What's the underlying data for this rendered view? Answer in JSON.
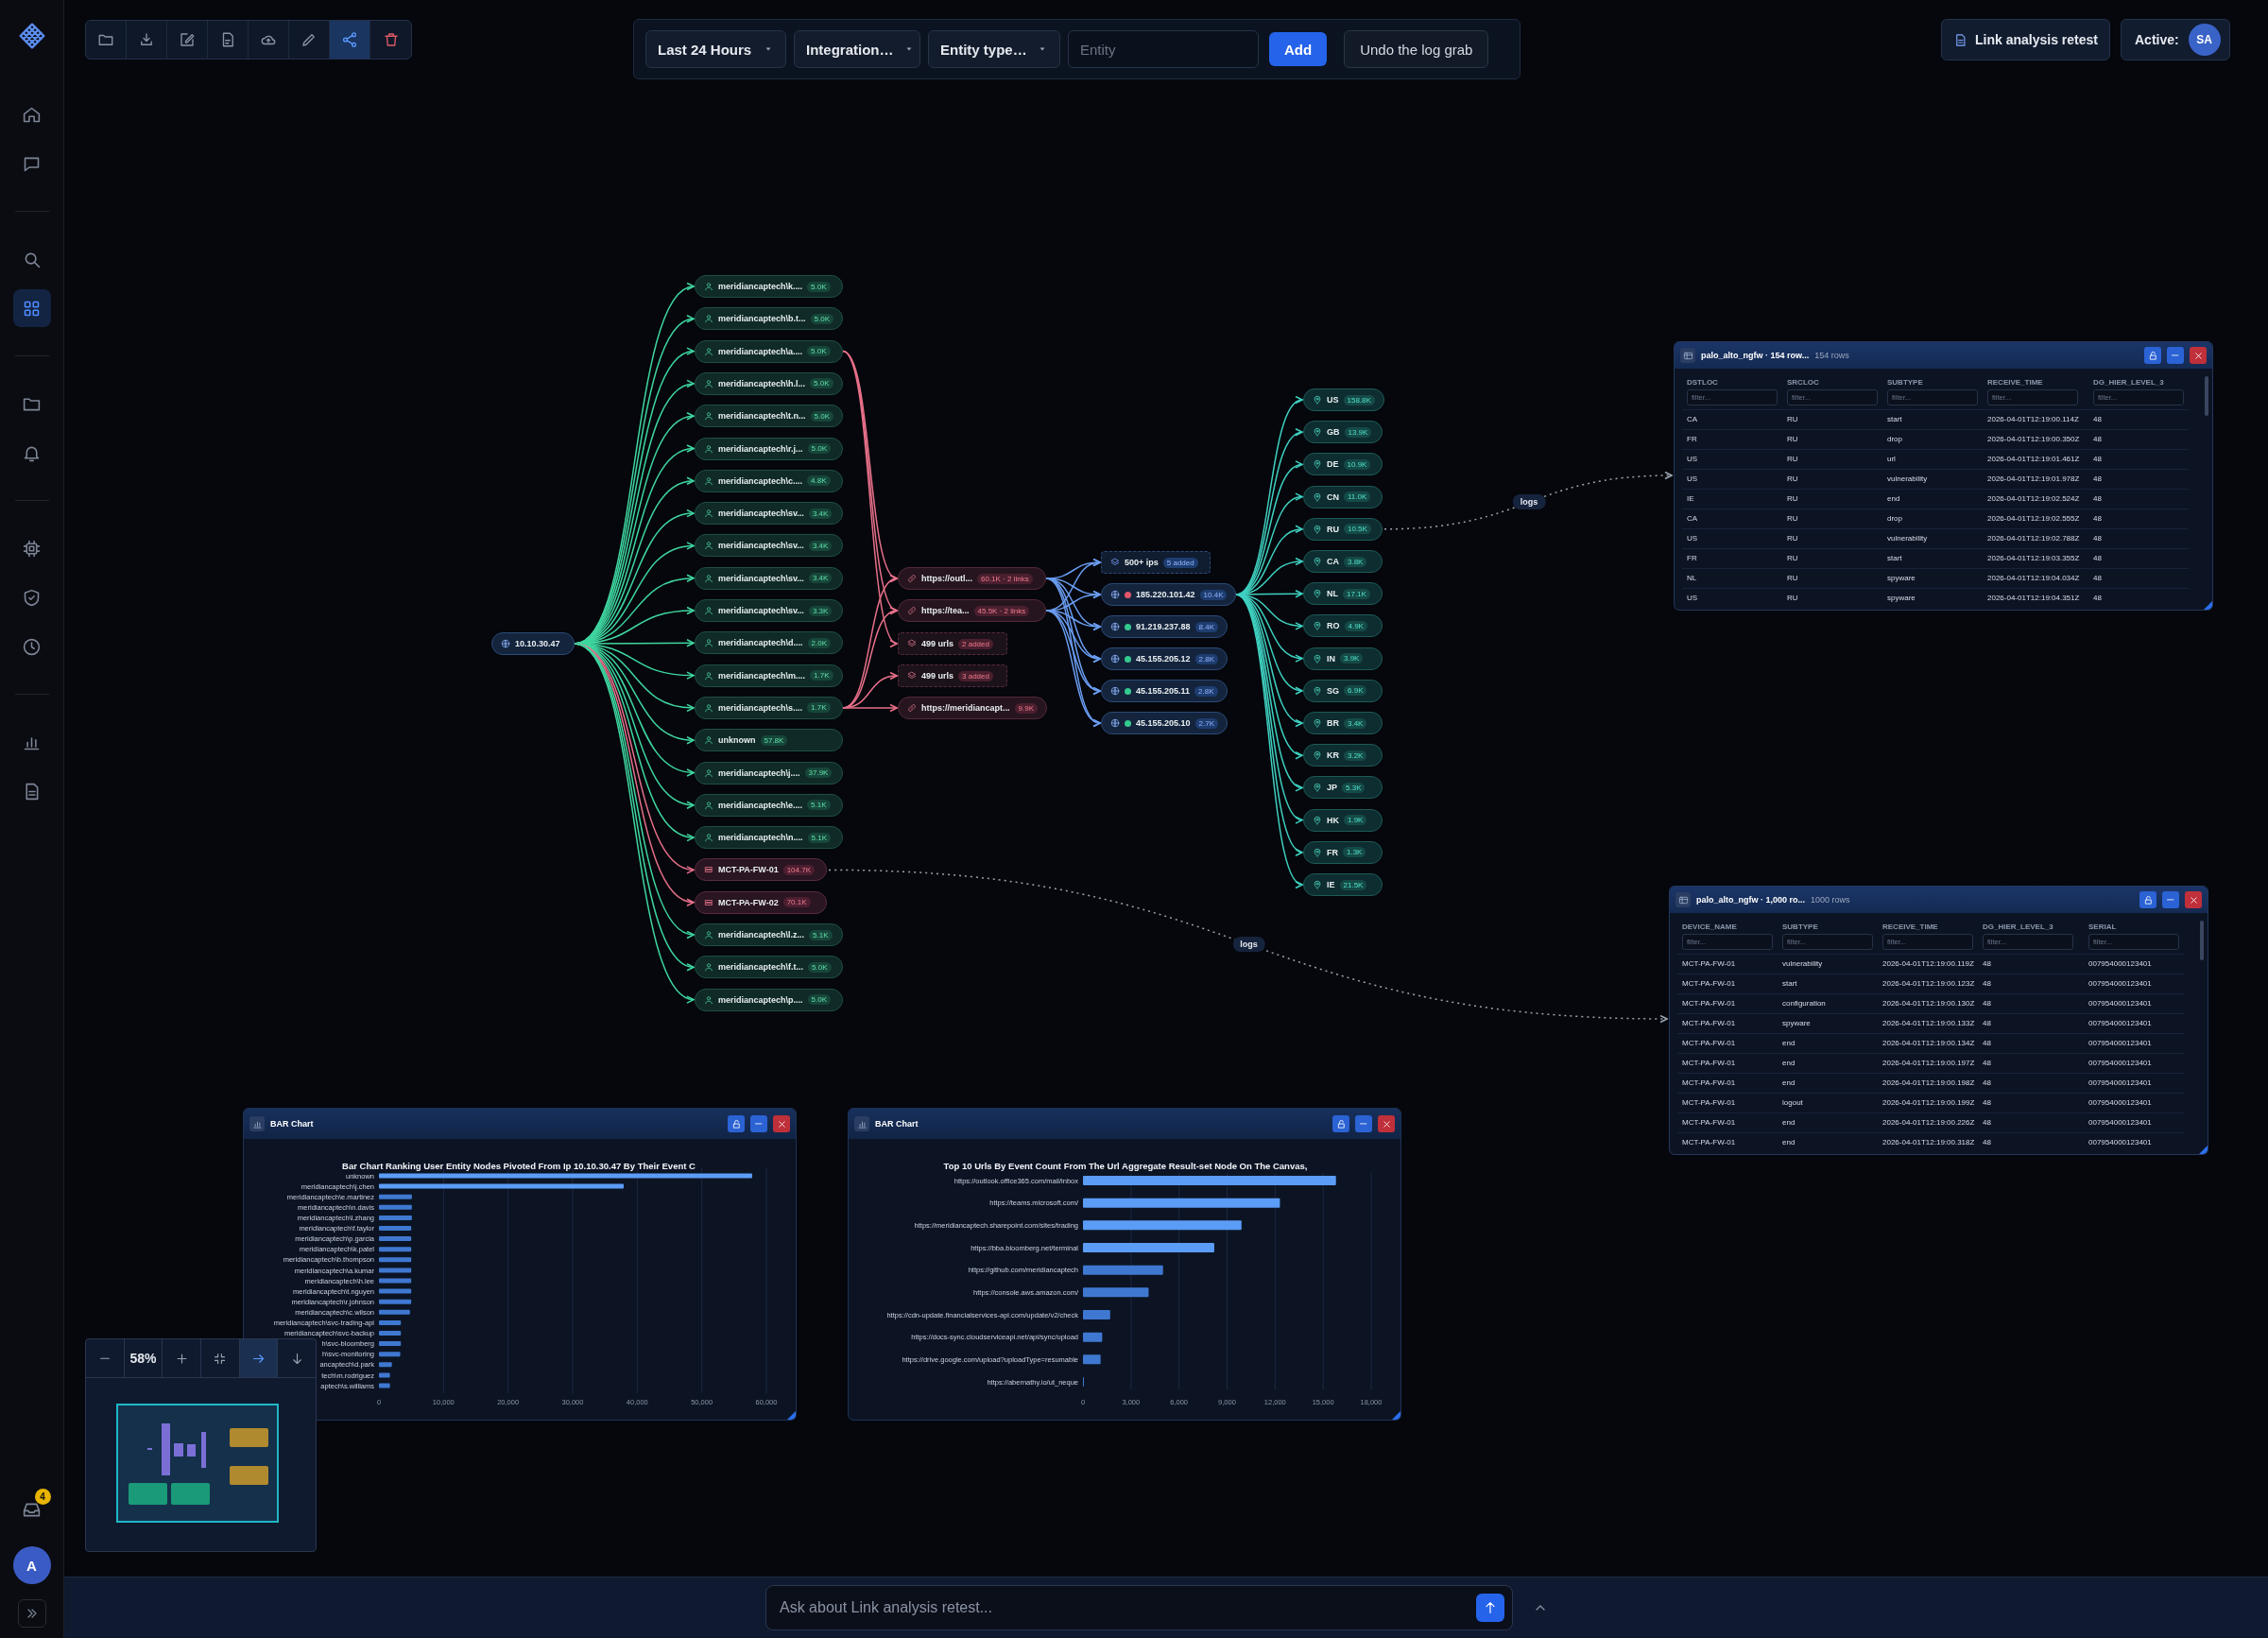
{
  "sidebar": {
    "groups": [
      {
        "items": [
          {
            "kind": "home",
            "selected": false
          },
          {
            "kind": "chat",
            "selected": false
          }
        ]
      },
      {
        "items": [
          {
            "kind": "search",
            "selected": false
          },
          {
            "kind": "grid",
            "selected": true
          }
        ]
      },
      {
        "items": [
          {
            "kind": "folder",
            "selected": false
          },
          {
            "kind": "bell",
            "selected": false
          }
        ]
      },
      {
        "items": [
          {
            "kind": "chip",
            "selected": false
          },
          {
            "kind": "shield",
            "selected": false
          },
          {
            "kind": "clock",
            "selected": false
          }
        ]
      },
      {
        "items": [
          {
            "kind": "chart",
            "selected": false
          },
          {
            "kind": "doc",
            "selected": false
          }
        ]
      }
    ],
    "inbox": {
      "badge": "4"
    },
    "account": {
      "initial": "A"
    }
  },
  "toolbar": [
    {
      "kind": "folder",
      "selected": false
    },
    {
      "kind": "download",
      "selected": false
    },
    {
      "kind": "edit",
      "selected": false
    },
    {
      "kind": "file",
      "selected": false
    },
    {
      "kind": "cloud",
      "selected": false
    },
    {
      "kind": "pencil",
      "selected": false
    },
    {
      "kind": "share",
      "selected": true
    },
    {
      "kind": "trash",
      "selected": false
    }
  ],
  "filters": {
    "time_range": "Last 24 Hours",
    "integration": "Integration…",
    "entity_type": "Entity type…",
    "entity": {
      "placeholder": "Entity"
    },
    "add_button": "Add",
    "undo_button": "Undo the log grab"
  },
  "session": {
    "project_button": "Link analysis retest",
    "active_label": "Active:",
    "active_user": "SA"
  },
  "graph": {
    "root": {
      "kind": "ip",
      "label": "10.10.30.47"
    },
    "users": [
      {
        "kind": "user",
        "label": "meridiancaptech\\k....",
        "count": "5.0K"
      },
      {
        "kind": "user",
        "label": "meridiancaptech\\b.t...",
        "count": "5.0K"
      },
      {
        "kind": "user",
        "label": "meridiancaptech\\a....",
        "count": "5.0K"
      },
      {
        "kind": "user",
        "label": "meridiancaptech\\h.l...",
        "count": "5.0K"
      },
      {
        "kind": "user",
        "label": "meridiancaptech\\t.n...",
        "count": "5.0K"
      },
      {
        "kind": "user",
        "label": "meridiancaptech\\r.j...",
        "count": "5.0K"
      },
      {
        "kind": "user",
        "label": "meridiancaptech\\c....",
        "count": "4.8K"
      },
      {
        "kind": "user",
        "label": "meridiancaptech\\sv...",
        "count": "3.4K"
      },
      {
        "kind": "user",
        "label": "meridiancaptech\\sv...",
        "count": "3.4K"
      },
      {
        "kind": "user",
        "label": "meridiancaptech\\sv...",
        "count": "3.4K"
      },
      {
        "kind": "user",
        "label": "meridiancaptech\\sv...",
        "count": "3.3K"
      },
      {
        "kind": "user",
        "label": "meridiancaptech\\d....",
        "count": "2.0K"
      },
      {
        "kind": "user",
        "label": "meridiancaptech\\m....",
        "count": "1.7K"
      },
      {
        "kind": "user",
        "label": "meridiancaptech\\s....",
        "count": "1.7K"
      },
      {
        "kind": "user",
        "label": "unknown",
        "count": "57.8K"
      },
      {
        "kind": "user",
        "label": "meridiancaptech\\j....",
        "count": "37.9K"
      },
      {
        "kind": "user",
        "label": "meridiancaptech\\e....",
        "count": "5.1K"
      },
      {
        "kind": "user",
        "label": "meridiancaptech\\n....",
        "count": "5.1K"
      },
      {
        "kind": "device",
        "label": "MCT-PA-FW-01",
        "count": "104.7K"
      },
      {
        "kind": "device",
        "label": "MCT-PA-FW-02",
        "count": "70.1K"
      },
      {
        "kind": "user",
        "label": "meridiancaptech\\l.z...",
        "count": "5.1K"
      },
      {
        "kind": "user",
        "label": "meridiancaptech\\f.t...",
        "count": "5.0K"
      },
      {
        "kind": "user",
        "label": "meridiancaptech\\p....",
        "count": "5.0K"
      }
    ],
    "urls": [
      {
        "kind": "url",
        "label": "https://outl...",
        "count": "60.1K · 2 links"
      },
      {
        "kind": "url",
        "label": "https://tea...",
        "count": "45.5K · 2 links"
      },
      {
        "kind": "group",
        "label": "499 urls",
        "count": "2 added"
      },
      {
        "kind": "group",
        "label": "499 urls",
        "count": "3 added"
      },
      {
        "kind": "url",
        "label": "https://meridiancapt...",
        "count": "9.9K"
      }
    ],
    "ips": [
      {
        "kind": "group",
        "label": "500+ ips",
        "count": "5 added"
      },
      {
        "kind": "ip",
        "label": "185.220.101.42",
        "count": "10.4K",
        "color": "#e0566a"
      },
      {
        "kind": "ip",
        "label": "91.219.237.88",
        "count": "8.4K",
        "color": "#34c98e"
      },
      {
        "kind": "ip",
        "label": "45.155.205.12",
        "count": "2.8K",
        "color": "#34c98e"
      },
      {
        "kind": "ip",
        "label": "45.155.205.11",
        "count": "2.8K",
        "color": "#34c98e"
      },
      {
        "kind": "ip",
        "label": "45.155.205.10",
        "count": "2.7K",
        "color": "#34c98e"
      }
    ],
    "countries": [
      {
        "kind": "country",
        "label": "US",
        "count": "158.8K"
      },
      {
        "kind": "country",
        "label": "GB",
        "count": "13.9K"
      },
      {
        "kind": "country",
        "label": "DE",
        "count": "10.9K"
      },
      {
        "kind": "country",
        "label": "CN",
        "count": "11.0K"
      },
      {
        "kind": "country",
        "label": "RU",
        "count": "10.5K"
      },
      {
        "kind": "country",
        "label": "CA",
        "count": "3.8K"
      },
      {
        "kind": "country",
        "label": "NL",
        "count": "17.1K"
      },
      {
        "kind": "country",
        "label": "RO",
        "count": "4.9K"
      },
      {
        "kind": "country",
        "label": "IN",
        "count": "3.9K"
      },
      {
        "kind": "country",
        "label": "SG",
        "count": "6.9K"
      },
      {
        "kind": "country",
        "label": "BR",
        "count": "3.4K"
      },
      {
        "kind": "country",
        "label": "KR",
        "count": "3.2K"
      },
      {
        "kind": "country",
        "label": "JP",
        "count": "5.3K"
      },
      {
        "kind": "country",
        "label": "HK",
        "count": "1.9K"
      },
      {
        "kind": "country",
        "label": "FR",
        "count": "1.3K"
      },
      {
        "kind": "country",
        "label": "IE",
        "count": "21.5K"
      }
    ],
    "edge_labels": [
      {
        "text": "logs"
      },
      {
        "text": "logs"
      }
    ]
  },
  "tables": [
    {
      "title": "palo_alto_ngfw · 154 row...",
      "row_count": "154 rows",
      "columns": [
        {
          "name": "DSTLOC",
          "filter": {
            "placeholder": "filter..."
          }
        },
        {
          "name": "SRCLOC",
          "filter": {
            "placeholder": "filter..."
          }
        },
        {
          "name": "SUBTYPE",
          "filter": {
            "placeholder": "filter..."
          }
        },
        {
          "name": "RECEIVE_TIME",
          "filter": {
            "placeholder": "filter..."
          }
        },
        {
          "name": "DG_HIER_LEVEL_3",
          "filter": {
            "placeholder": "filter..."
          }
        }
      ],
      "rows": [
        [
          "CA",
          "RU",
          "start",
          "2026-04-01T12:19:00.114Z",
          "48"
        ],
        [
          "FR",
          "RU",
          "drop",
          "2026-04-01T12:19:00.350Z",
          "48"
        ],
        [
          "US",
          "RU",
          "url",
          "2026-04-01T12:19:01.461Z",
          "48"
        ],
        [
          "US",
          "RU",
          "vulnerability",
          "2026-04-01T12:19:01.978Z",
          "48"
        ],
        [
          "IE",
          "RU",
          "end",
          "2026-04-01T12:19:02.524Z",
          "48"
        ],
        [
          "CA",
          "RU",
          "drop",
          "2026-04-01T12:19:02.555Z",
          "48"
        ],
        [
          "US",
          "RU",
          "vulnerability",
          "2026-04-01T12:19:02.788Z",
          "48"
        ],
        [
          "FR",
          "RU",
          "start",
          "2026-04-01T12:19:03.355Z",
          "48"
        ],
        [
          "NL",
          "RU",
          "spyware",
          "2026-04-01T12:19:04.034Z",
          "48"
        ],
        [
          "US",
          "RU",
          "spyware",
          "2026-04-01T12:19:04.351Z",
          "48"
        ]
      ]
    },
    {
      "title": "palo_alto_ngfw · 1,000 ro...",
      "row_count": "1000 rows",
      "columns": [
        {
          "name": "DEVICE_NAME",
          "filter": {
            "placeholder": "filter..."
          }
        },
        {
          "name": "SUBTYPE",
          "filter": {
            "placeholder": "filter..."
          }
        },
        {
          "name": "RECEIVE_TIME",
          "filter": {
            "placeholder": "filter..."
          }
        },
        {
          "name": "DG_HIER_LEVEL_3",
          "filter": {
            "placeholder": "filter..."
          }
        },
        {
          "name": "SERIAL",
          "filter": {
            "placeholder": "filter..."
          }
        }
      ],
      "rows": [
        [
          "MCT-PA-FW-01",
          "vulnerability",
          "2026-04-01T12:19:00.119Z",
          "48",
          "007954000123401"
        ],
        [
          "MCT-PA-FW-01",
          "start",
          "2026-04-01T12:19:00.123Z",
          "48",
          "007954000123401"
        ],
        [
          "MCT-PA-FW-01",
          "configuration",
          "2026-04-01T12:19:00.130Z",
          "48",
          "007954000123401"
        ],
        [
          "MCT-PA-FW-01",
          "spyware",
          "2026-04-01T12:19:00.133Z",
          "48",
          "007954000123401"
        ],
        [
          "MCT-PA-FW-01",
          "end",
          "2026-04-01T12:19:00.134Z",
          "48",
          "007954000123401"
        ],
        [
          "MCT-PA-FW-01",
          "end",
          "2026-04-01T12:19:00.197Z",
          "48",
          "007954000123401"
        ],
        [
          "MCT-PA-FW-01",
          "end",
          "2026-04-01T12:19:00.198Z",
          "48",
          "007954000123401"
        ],
        [
          "MCT-PA-FW-01",
          "logout",
          "2026-04-01T12:19:00.199Z",
          "48",
          "007954000123401"
        ],
        [
          "MCT-PA-FW-01",
          "end",
          "2026-04-01T12:19:00.226Z",
          "48",
          "007954000123401"
        ],
        [
          "MCT-PA-FW-01",
          "end",
          "2026-04-01T12:19:00.318Z",
          "48",
          "007954000123401"
        ]
      ]
    }
  ],
  "charts": [
    {
      "title": "BAR Chart",
      "chart_data": {
        "type": "bar",
        "orientation": "horizontal",
        "title": "Bar Chart Ranking User Entity Nodes Pivoted From Ip 10.10.30.47 By Their Event C",
        "categories": [
          "unknown",
          "meridiancaptech\\j.chen",
          "meridiancaptech\\e.martinez",
          "meridiancaptech\\n.davis",
          "meridiancaptech\\l.zhang",
          "meridiancaptech\\f.taylor",
          "meridiancaptech\\p.garcia",
          "meridiancaptech\\k.patel",
          "meridiancaptech\\b.thompson",
          "meridiancaptech\\a.kumar",
          "meridiancaptech\\h.lee",
          "meridiancaptech\\t.nguyen",
          "meridiancaptech\\r.johnson",
          "meridiancaptech\\c.wilson",
          "meridiancaptech\\svc-trading-api",
          "meridiancaptech\\svc-backup",
          "h\\svc-bloomberg",
          "h\\svc-monitoring",
          "ancaptech\\d.park",
          "tech\\m.rodriguez",
          "aptech\\s.williams"
        ],
        "values": [
          57800,
          37900,
          5100,
          5100,
          5100,
          5000,
          5000,
          5000,
          5000,
          5000,
          5000,
          5000,
          5000,
          4800,
          3400,
          3400,
          3400,
          3300,
          2000,
          1700,
          1700
        ],
        "xlim": [
          0,
          60000
        ],
        "grid": true,
        "xticks": [
          {
            "value": 0,
            "label": "0"
          },
          {
            "value": 10000,
            "label": "10,000"
          },
          {
            "value": 20000,
            "label": "20,000"
          },
          {
            "value": 30000,
            "label": "30,000"
          },
          {
            "value": 40000,
            "label": "40,000"
          },
          {
            "value": 50000,
            "label": "50,000"
          },
          {
            "value": 60000,
            "label": "60,000"
          }
        ]
      }
    },
    {
      "title": "BAR Chart",
      "chart_data": {
        "type": "bar",
        "orientation": "horizontal",
        "title": "Top 10 Urls By Event Count From The Url Aggregate Result-set Node On The Canvas,",
        "categories": [
          "https://outlook.office365.com/mail/inbox",
          "https://teams.microsoft.com/",
          "https://meridiancaptech.sharepoint.com/sites/trading",
          "https://bba.bloomberg.net/terminal",
          "https://github.com/meridiancaptech",
          "https://console.aws.amazon.com/",
          "https://cdn-update.financialservices-api.com/update/v2/check",
          "https://docs-sync.cloudserviceapi.net/api/sync/upload",
          "https://drive.google.com/upload?uploadType=resumable",
          "https://abernathy.io/ut_neque"
        ],
        "values": [
          15800,
          12300,
          9900,
          8200,
          5000,
          4100,
          1700,
          1200,
          1100,
          50
        ],
        "xlim": [
          0,
          18000
        ],
        "grid": true,
        "xticks": [
          {
            "value": 0,
            "label": "0"
          },
          {
            "value": 3000,
            "label": "3,000"
          },
          {
            "value": 6000,
            "label": "6,000"
          },
          {
            "value": 9000,
            "label": "9,000"
          },
          {
            "value": 12000,
            "label": "12,000"
          },
          {
            "value": 15000,
            "label": "15,000"
          },
          {
            "value": 18000,
            "label": "18,000"
          }
        ]
      }
    }
  ],
  "minimap": {
    "controls": [
      {
        "kind": "zoom_out",
        "selected": false
      },
      {
        "kind": "zoom_level",
        "text": "58%"
      },
      {
        "kind": "zoom_in",
        "selected": false
      },
      {
        "kind": "fit",
        "selected": false
      },
      {
        "kind": "pan_right",
        "selected": true
      },
      {
        "kind": "pan_down",
        "selected": false
      }
    ]
  },
  "chat": {
    "placeholder": "Ask about Link analysis retest..."
  }
}
